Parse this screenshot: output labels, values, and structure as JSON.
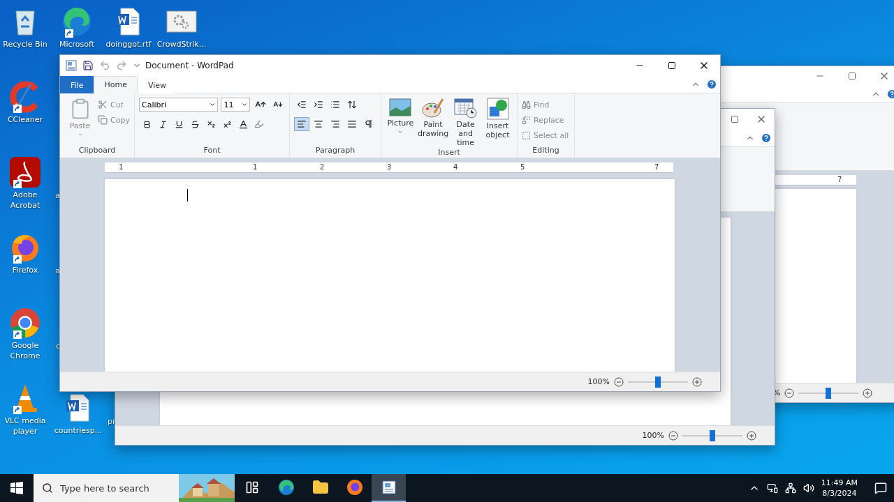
{
  "desktop_icons": [
    {
      "label": "Recycle Bin",
      "kind": "recycle",
      "shortcut": false
    },
    {
      "label": "Microsoft",
      "kind": "edge",
      "shortcut": true
    },
    {
      "label": "doinggot.rtf",
      "kind": "word",
      "shortcut": false
    },
    {
      "label": "CrowdStrik...",
      "kind": "gears",
      "shortcut": false
    },
    {
      "label": "CCleaner",
      "kind": "ccleaner",
      "shortcut": true
    },
    {
      "label": "Adobe Acrobat",
      "kind": "acrobat",
      "shortcut": true
    },
    {
      "label": "Firefox",
      "kind": "firefox",
      "shortcut": true
    },
    {
      "label": "Google Chrome",
      "kind": "chrome",
      "shortcut": true
    },
    {
      "label": "VLC media player",
      "kind": "vlc",
      "shortcut": true
    },
    {
      "label": "countriesp...",
      "kind": "word",
      "shortcut": false
    }
  ],
  "hidden_icon_labels": [
    "a",
    "a",
    "c",
    "pr"
  ],
  "back_window_right": {
    "ruler_labels": [
      "7"
    ],
    "zoom": "%",
    "level": 0.5
  },
  "back_window_middle": {
    "zoom": "100%",
    "level": 0.5
  },
  "wordpad": {
    "title": "Document - WordPad",
    "tabs": [
      {
        "label": "File",
        "kind": "file",
        "selected": false
      },
      {
        "label": "Home",
        "kind": "tab",
        "selected": true
      },
      {
        "label": "View",
        "kind": "tab",
        "selected": false
      }
    ],
    "clipboard": {
      "paste": "Paste",
      "cut": "Cut",
      "copy": "Copy",
      "label": "Clipboard"
    },
    "font": {
      "name": "Calibri",
      "size": "11",
      "label": "Font"
    },
    "paragraph": {
      "label": "Paragraph",
      "alignments": [
        {
          "kind": "left",
          "selected": true
        },
        {
          "kind": "center",
          "selected": false
        },
        {
          "kind": "right",
          "selected": false
        },
        {
          "kind": "justify",
          "selected": false
        }
      ]
    },
    "insert": {
      "label": "Insert",
      "items": [
        {
          "label": "Picture",
          "kind": "picture",
          "dropdown": true
        },
        {
          "label": "Paint drawing",
          "kind": "paint",
          "dropdown": false
        },
        {
          "label": "Date and time",
          "kind": "date",
          "dropdown": false
        },
        {
          "label": "Insert object",
          "kind": "object",
          "dropdown": false
        }
      ]
    },
    "editing": {
      "label": "Editing",
      "items": [
        {
          "label": "Find",
          "kind": "find"
        },
        {
          "label": "Replace",
          "kind": "replace"
        },
        {
          "label": "Select all",
          "kind": "select"
        }
      ]
    },
    "ruler_labels": [
      "1",
      "1",
      "2",
      "3",
      "4",
      "5",
      "7"
    ],
    "zoom": "100%",
    "level": 0.5
  },
  "taskbar": {
    "search_placeholder": "Type here to search",
    "apps": [
      {
        "kind": "taskview",
        "selected": false
      },
      {
        "kind": "edge",
        "selected": false
      },
      {
        "kind": "explorer",
        "selected": false
      },
      {
        "kind": "firefox",
        "selected": false
      },
      {
        "kind": "wordpad",
        "selected": true
      }
    ],
    "time": "11:49 AM",
    "date": "8/3/2024"
  }
}
